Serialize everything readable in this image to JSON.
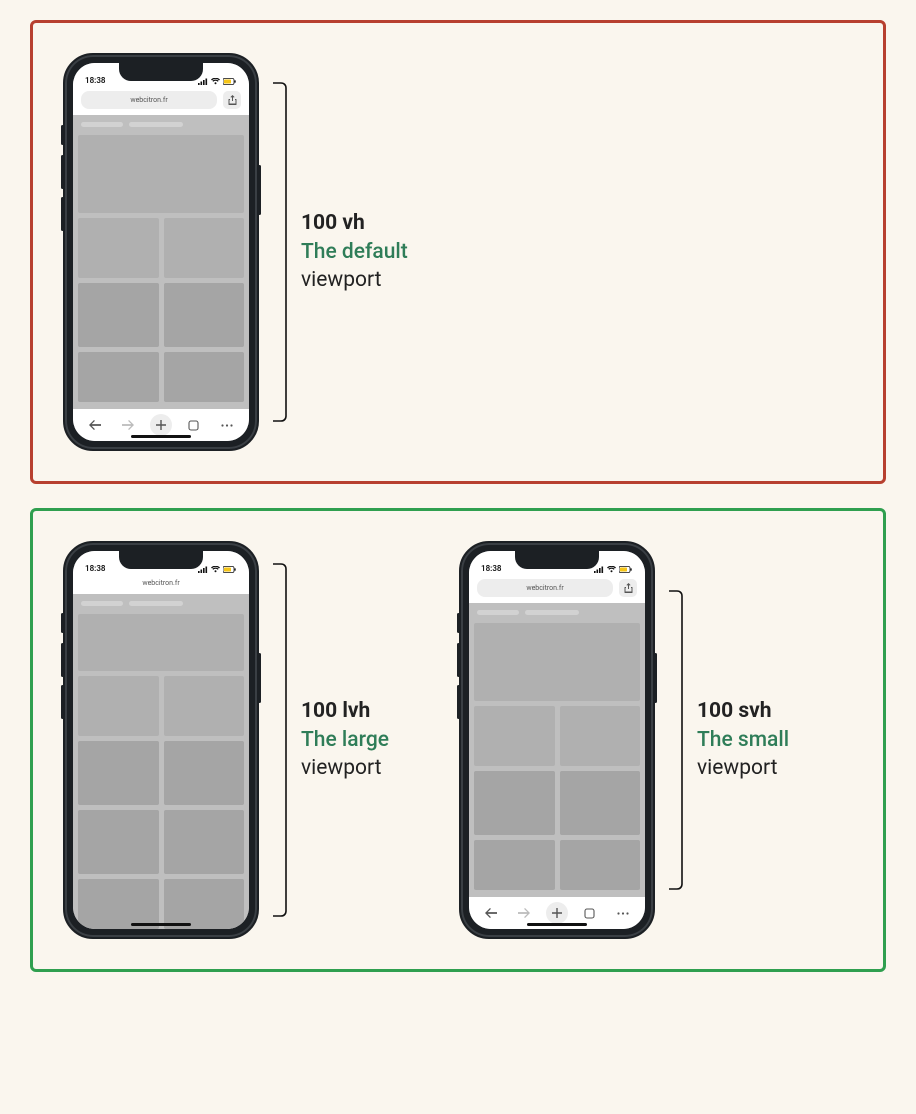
{
  "status": {
    "time": "18:38"
  },
  "browser": {
    "url": "webcitron.fr"
  },
  "units": {
    "vh": {
      "unit": "100 vh",
      "desc": "The default",
      "viewport": "viewport"
    },
    "lvh": {
      "unit": "100 lvh",
      "desc": "The large",
      "viewport": "viewport"
    },
    "svh": {
      "unit": "100 svh",
      "desc": "The small",
      "viewport": "viewport"
    }
  }
}
